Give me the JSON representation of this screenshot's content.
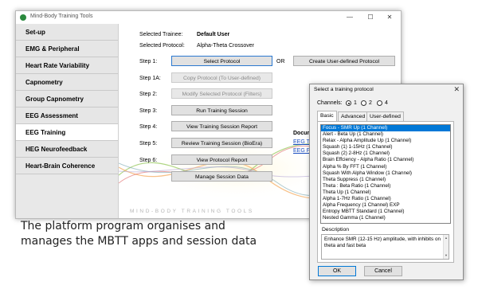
{
  "window": {
    "title": "Mind-Body Training Tools",
    "controls": {
      "minimize": "—",
      "maximize": "☐",
      "close": "✕"
    }
  },
  "sidebar": {
    "items": [
      {
        "label": "Set-up"
      },
      {
        "label": "EMG & Peripheral"
      },
      {
        "label": "Heart Rate Variability"
      },
      {
        "label": "Capnometry"
      },
      {
        "label": "Group Capnometry"
      },
      {
        "label": "EEG Assessment"
      },
      {
        "label": "EEG Training",
        "active": true
      },
      {
        "label": "HEG Neurofeedback"
      },
      {
        "label": "Heart-Brain Coherence"
      }
    ]
  },
  "main": {
    "trainee_label": "Selected Trainee:",
    "trainee_value": "Default User",
    "protocol_label": "Selected Protocol:",
    "protocol_value": "Alpha-Theta Crossover",
    "or_label": "OR",
    "create_button": "Create User-defined Protocol",
    "steps": [
      {
        "label": "Step 1:",
        "button": "Select Protocol",
        "state": "primary"
      },
      {
        "label": "Step 1A:",
        "button": "Copy Protocol (To User-defined)",
        "state": "disabled"
      },
      {
        "label": "Step 2:",
        "button": "Modify Selected Protocol (Filters)",
        "state": "disabled"
      },
      {
        "label": "Step 3:",
        "button": "Run Training Session",
        "state": "normal"
      },
      {
        "label": "Step 4:",
        "button": "View Training Session Report",
        "state": "normal"
      },
      {
        "label": "Step 5:",
        "button": "Review Training Session (BioEra)",
        "state": "normal"
      },
      {
        "label": "Step 6:",
        "button": "View Protocol Report",
        "state": "normal"
      },
      {
        "label": "",
        "button": "Manage Session Data",
        "state": "normal"
      }
    ],
    "docs_heading": "Docum",
    "doc_links": [
      "EEG Tr",
      "EEG Fe"
    ],
    "watermark": "MIND-BODY TRAINING TOOLS"
  },
  "dialog": {
    "title": "Select a training protocol",
    "close": "✕",
    "channels_label": "Channels:",
    "channel_options": [
      {
        "label": "1",
        "selected": true
      },
      {
        "label": "2"
      },
      {
        "label": "4"
      }
    ],
    "tabs": [
      {
        "label": "Basic",
        "active": true
      },
      {
        "label": "Advanced"
      },
      {
        "label": "User-defined"
      }
    ],
    "protocols": [
      "Focus - SMR Up (1 Channel)",
      "Alert - Beta Up (1 Channel)",
      "Relax - Alpha Amplitude Up (1 Channel)",
      "Squash (1) 1-15Hz (1 Channel)",
      "Squash (2) 2-8Hz (1 Channel)",
      "Brain Effciency - Alpha Ratio (1 Channel)",
      "Alpha % By FFT (1 Channel)",
      "Squash With Alpha Window (1 Channel)",
      "Theta Suppress (1 Channel)",
      "Theta : Beta Ratio (1 Channel)",
      "Theta Up (1 Channel)",
      "Alpha 1-7Hz Ratio (1 Channel)",
      "Alpha Frequency (1 Channel) EXP",
      "Entropy MBTT Standard (1 Channel)",
      "Nested Gamma (1 Channel)"
    ],
    "selected_protocol": "Focus - SMR Up (1 Channel)",
    "description_label": "Description",
    "description": "Enhance SMR (12-15 Hz) amplitude, with inhibits on theta and fast beta",
    "ok_button": "OK",
    "cancel_button": "Cancel"
  },
  "caption": {
    "line1": "The platform program organises and",
    "line2": "manages the MBTT apps and session data"
  }
}
